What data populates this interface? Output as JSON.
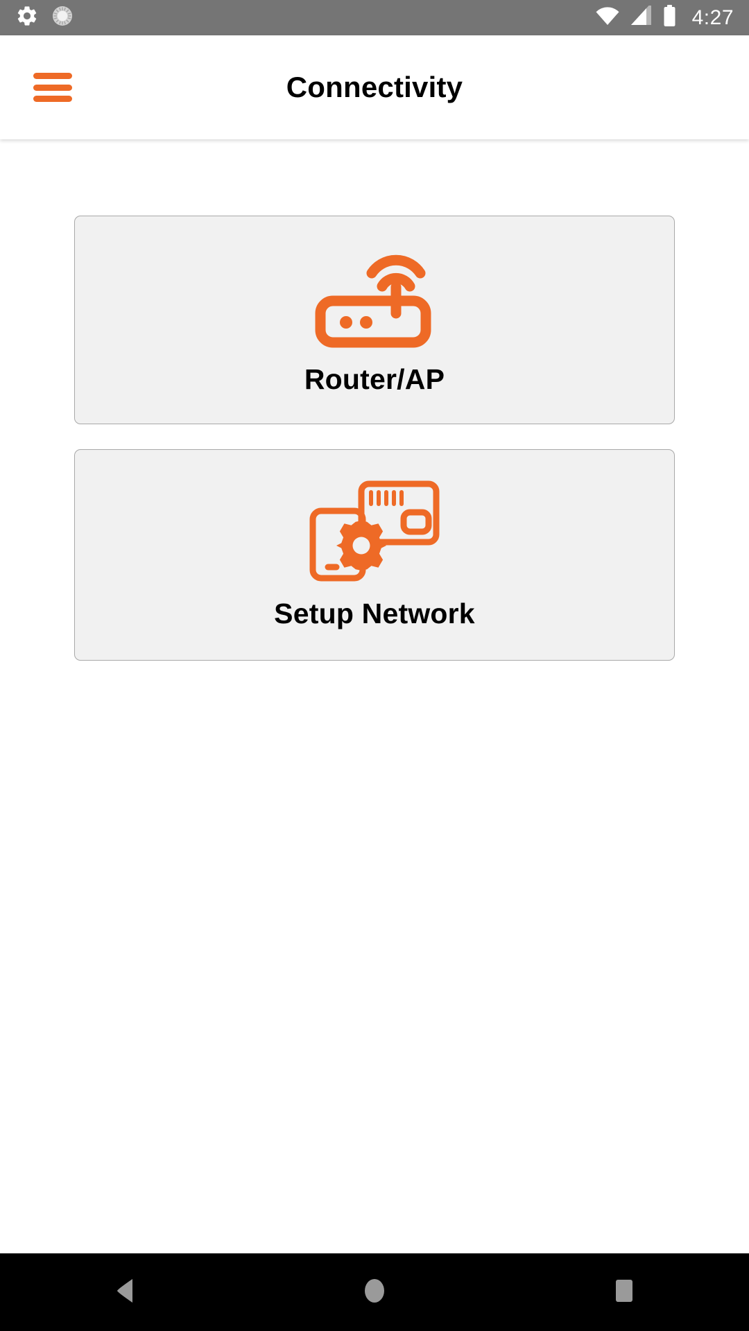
{
  "status_bar": {
    "background_color": "#757575",
    "time": "4:27",
    "left_icons": [
      {
        "name": "settings-gear-icon",
        "label": "Settings"
      },
      {
        "name": "brightness-sun-icon",
        "label": "Brightness"
      }
    ],
    "right_icons": [
      {
        "name": "wifi-icon",
        "label": "Wi-Fi",
        "state": "full"
      },
      {
        "name": "cellular-signal-icon",
        "label": "Cellular signal",
        "state": "partial"
      },
      {
        "name": "battery-icon",
        "label": "Battery",
        "state": "full"
      }
    ]
  },
  "app_bar": {
    "title": "Connectivity",
    "menu_icon": "hamburger-menu-icon",
    "accent_color": "#EE6A26",
    "background_color": "#FFFFFF",
    "title_color": "#000000"
  },
  "main": {
    "background_color": "#FFFFFF",
    "card_background_color": "#F1F1F1",
    "card_border_color": "#A8A8A8",
    "cards": [
      {
        "id": "router-ap",
        "label": "Router/AP",
        "icon": "router-icon"
      },
      {
        "id": "setup-network",
        "label": "Setup Network",
        "icon": "setup-network-icon"
      }
    ]
  },
  "nav_bar": {
    "background_color": "#000000",
    "icon_color": "#9A9A9A",
    "buttons": [
      {
        "name": "back-button",
        "icon": "back-triangle-icon",
        "label": "Back"
      },
      {
        "name": "home-button",
        "icon": "home-circle-icon",
        "label": "Home"
      },
      {
        "name": "recents-button",
        "icon": "recents-square-icon",
        "label": "Recent apps"
      }
    ]
  }
}
